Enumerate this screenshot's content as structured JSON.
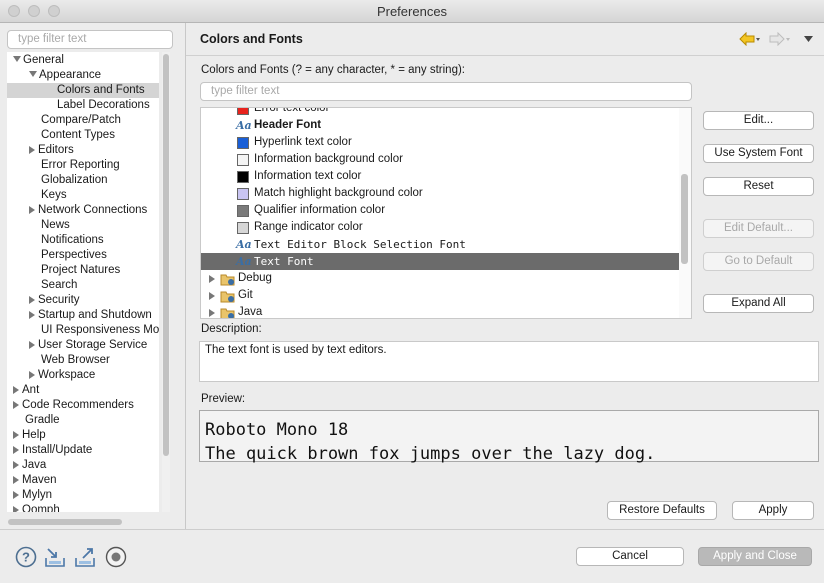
{
  "window": {
    "title": "Preferences"
  },
  "left": {
    "filter_placeholder": "type filter text",
    "tree": [
      {
        "label": "General",
        "depth": 0,
        "state": "expanded"
      },
      {
        "label": "Appearance",
        "depth": 1,
        "state": "expanded"
      },
      {
        "label": "Colors and Fonts",
        "depth": 2,
        "state": "leaf",
        "selected": true
      },
      {
        "label": "Label Decorations",
        "depth": 2,
        "state": "leaf"
      },
      {
        "label": "Compare/Patch",
        "depth": 1,
        "state": "leaf"
      },
      {
        "label": "Content Types",
        "depth": 1,
        "state": "leaf"
      },
      {
        "label": "Editors",
        "depth": 1,
        "state": "collapsed"
      },
      {
        "label": "Error Reporting",
        "depth": 1,
        "state": "leaf"
      },
      {
        "label": "Globalization",
        "depth": 1,
        "state": "leaf"
      },
      {
        "label": "Keys",
        "depth": 1,
        "state": "leaf"
      },
      {
        "label": "Network Connections",
        "depth": 1,
        "state": "collapsed"
      },
      {
        "label": "News",
        "depth": 1,
        "state": "leaf"
      },
      {
        "label": "Notifications",
        "depth": 1,
        "state": "leaf"
      },
      {
        "label": "Perspectives",
        "depth": 1,
        "state": "leaf"
      },
      {
        "label": "Project Natures",
        "depth": 1,
        "state": "leaf"
      },
      {
        "label": "Search",
        "depth": 1,
        "state": "leaf"
      },
      {
        "label": "Security",
        "depth": 1,
        "state": "collapsed"
      },
      {
        "label": "Startup and Shutdown",
        "depth": 1,
        "state": "collapsed"
      },
      {
        "label": "UI Responsiveness Mo",
        "depth": 1,
        "state": "leaf"
      },
      {
        "label": "User Storage Service",
        "depth": 1,
        "state": "collapsed"
      },
      {
        "label": "Web Browser",
        "depth": 1,
        "state": "leaf"
      },
      {
        "label": "Workspace",
        "depth": 1,
        "state": "collapsed"
      },
      {
        "label": "Ant",
        "depth": 0,
        "state": "collapsed"
      },
      {
        "label": "Code Recommenders",
        "depth": 0,
        "state": "collapsed"
      },
      {
        "label": "Gradle",
        "depth": 0,
        "state": "leaf"
      },
      {
        "label": "Help",
        "depth": 0,
        "state": "collapsed"
      },
      {
        "label": "Install/Update",
        "depth": 0,
        "state": "collapsed"
      },
      {
        "label": "Java",
        "depth": 0,
        "state": "collapsed"
      },
      {
        "label": "Maven",
        "depth": 0,
        "state": "collapsed"
      },
      {
        "label": "Mylyn",
        "depth": 0,
        "state": "collapsed"
      },
      {
        "label": "Oomph",
        "depth": 0,
        "state": "collapsed"
      }
    ]
  },
  "page": {
    "title": "Colors and Fonts",
    "filter_label": "Colors and Fonts (? = any character, * = any string):",
    "filter_placeholder": "type filter text",
    "items": [
      {
        "kind": "color",
        "label": "Error text color",
        "color": "#e8231d"
      },
      {
        "kind": "font",
        "label": "Header Font",
        "bold": true
      },
      {
        "kind": "color",
        "label": "Hyperlink text color",
        "color": "#1a5fd6"
      },
      {
        "kind": "color",
        "label": "Information background color",
        "color": "#f5f5f5"
      },
      {
        "kind": "color",
        "label": "Information text color",
        "color": "#000000"
      },
      {
        "kind": "color",
        "label": "Match highlight background color",
        "color": "#c9c5f2"
      },
      {
        "kind": "color",
        "label": "Qualifier information color",
        "color": "#7a7a7a"
      },
      {
        "kind": "color",
        "label": "Range indicator color",
        "color": "#d6d6d6"
      },
      {
        "kind": "font",
        "label": "Text Editor Block Selection Font",
        "mono": true
      },
      {
        "kind": "font",
        "label": "Text Font",
        "mono": true,
        "selected": true
      },
      {
        "kind": "folder",
        "label": "Debug"
      },
      {
        "kind": "folder",
        "label": "Git"
      },
      {
        "kind": "folder",
        "label": "Java"
      }
    ],
    "buttons": {
      "edit": "Edit...",
      "use_system_font": "Use System Font",
      "reset": "Reset",
      "edit_default": "Edit Default...",
      "go_to_default": "Go to Default",
      "expand_all": "Expand All"
    },
    "description_label": "Description:",
    "description": "The text font is used by text editors.",
    "preview_label": "Preview:",
    "preview_line1": "Roboto Mono 18",
    "preview_line2": "The quick brown fox jumps over the lazy dog.",
    "restore_defaults": "Restore Defaults",
    "apply": "Apply"
  },
  "footer": {
    "cancel": "Cancel",
    "apply_and_close": "Apply and Close"
  },
  "colors": {
    "selection_dark": "#6b6b6b",
    "selection_light": "#d4d4d4",
    "nav_back": "#e8b40e"
  }
}
